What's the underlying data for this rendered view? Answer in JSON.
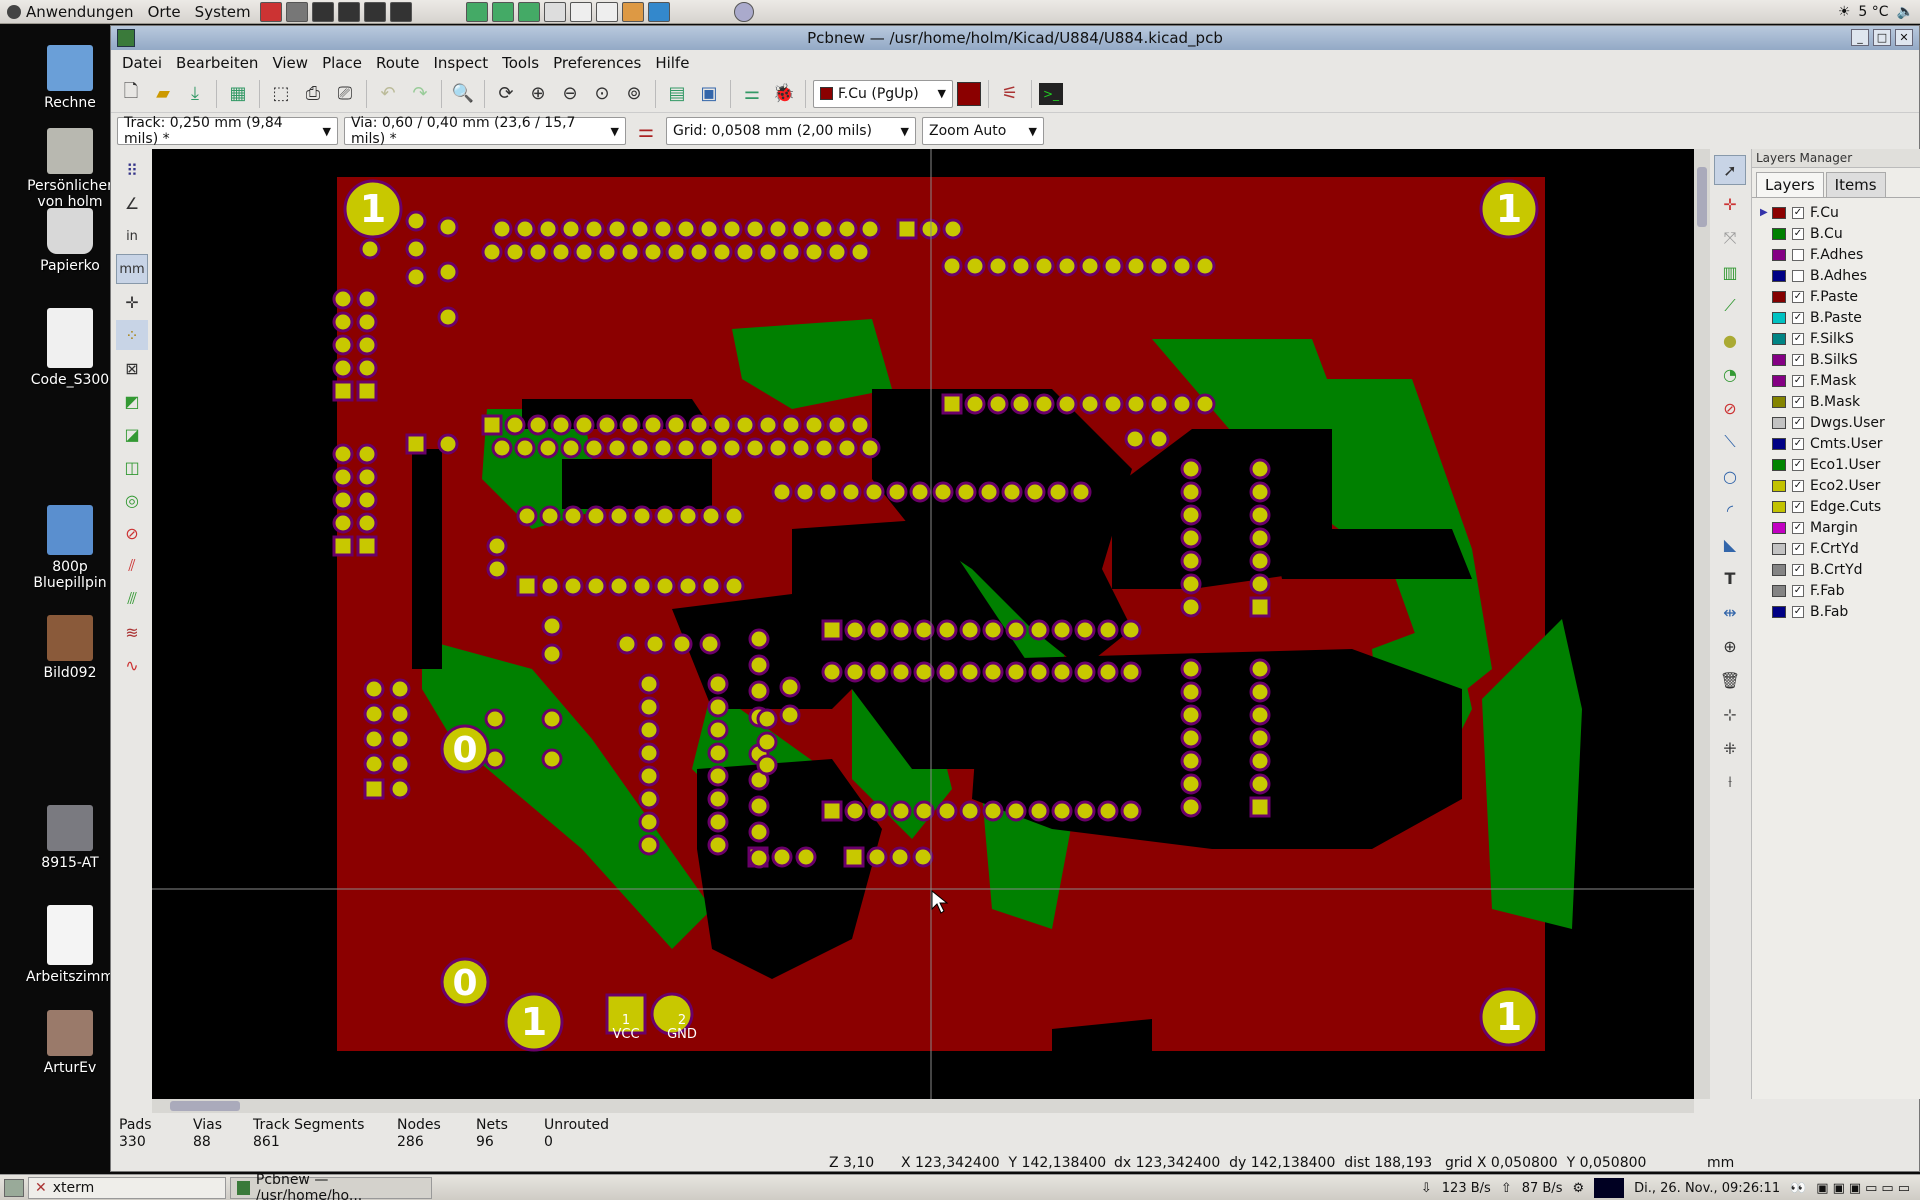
{
  "top_panel": {
    "menu": [
      "Anwendungen",
      "Orte",
      "System"
    ],
    "weather": "5 °C"
  },
  "desktop": {
    "icons": [
      "Rechne",
      "Persönlicher von holm",
      "Papierko",
      "Code_S300",
      "800p Bluepillpin",
      "Bild092",
      "8915-AT",
      "Arbeitszimm",
      "ArturEv"
    ]
  },
  "window": {
    "title": "Pcbnew — /usr/home/holm/Kicad/U884/U884.kicad_pcb",
    "menu": [
      "Datei",
      "Bearbeiten",
      "View",
      "Place",
      "Route",
      "Inspect",
      "Tools",
      "Preferences",
      "Hilfe"
    ],
    "layer_select": "F.Cu (PgUp)",
    "track": "Track: 0,250 mm (9,84 mils) *",
    "via": "Via: 0,60 / 0,40 mm (23,6 / 15,7 mils) *",
    "grid": "Grid: 0,0508 mm (2,00 mils)",
    "zoom": "Zoom Auto",
    "left_toolbar_units": [
      "in",
      "mm"
    ]
  },
  "canvas": {
    "corner_labels": [
      "1",
      "1",
      "1",
      "1",
      "1"
    ],
    "zero_labels": [
      "0",
      "0"
    ],
    "power_pads": [
      {
        "num": "1",
        "name": "VCC"
      },
      {
        "num": "2",
        "name": "GND"
      }
    ]
  },
  "layers_panel": {
    "title": "Layers Manager",
    "tabs": [
      "Layers",
      "Items"
    ],
    "layers": [
      {
        "name": "F.Cu",
        "color": "#8b0000",
        "checked": true
      },
      {
        "name": "B.Cu",
        "color": "#008000",
        "checked": true
      },
      {
        "name": "F.Adhes",
        "color": "#840084",
        "checked": false
      },
      {
        "name": "B.Adhes",
        "color": "#000084",
        "checked": false
      },
      {
        "name": "F.Paste",
        "color": "#840000",
        "checked": true
      },
      {
        "name": "B.Paste",
        "color": "#00c2c2",
        "checked": true
      },
      {
        "name": "F.SilkS",
        "color": "#008484",
        "checked": true
      },
      {
        "name": "B.SilkS",
        "color": "#840084",
        "checked": true
      },
      {
        "name": "F.Mask",
        "color": "#840084",
        "checked": true
      },
      {
        "name": "B.Mask",
        "color": "#848400",
        "checked": true
      },
      {
        "name": "Dwgs.User",
        "color": "#c2c2c2",
        "checked": true
      },
      {
        "name": "Cmts.User",
        "color": "#000084",
        "checked": true
      },
      {
        "name": "Eco1.User",
        "color": "#008400",
        "checked": true
      },
      {
        "name": "Eco2.User",
        "color": "#c2c200",
        "checked": true
      },
      {
        "name": "Edge.Cuts",
        "color": "#c2c200",
        "checked": true
      },
      {
        "name": "Margin",
        "color": "#c200c2",
        "checked": true
      },
      {
        "name": "F.CrtYd",
        "color": "#c2c2c2",
        "checked": true
      },
      {
        "name": "B.CrtYd",
        "color": "#848484",
        "checked": true
      },
      {
        "name": "F.Fab",
        "color": "#848484",
        "checked": true
      },
      {
        "name": "B.Fab",
        "color": "#000084",
        "checked": true
      }
    ]
  },
  "status": {
    "items": [
      {
        "label": "Pads",
        "value": "330"
      },
      {
        "label": "Vias",
        "value": "88"
      },
      {
        "label": "Track Segments",
        "value": "861"
      },
      {
        "label": "Nodes",
        "value": "286"
      },
      {
        "label": "Nets",
        "value": "96"
      },
      {
        "label": "Unrouted",
        "value": "0"
      }
    ],
    "zoom": "Z 3,10",
    "xy": "X 123,342400  Y 142,138400",
    "dxy": "dx 123,342400  dy 142,138400  dist 188,193",
    "grid": "grid X 0,050800  Y 0,050800",
    "units": "mm"
  },
  "taskbar": {
    "tasks": [
      "xterm",
      "Pcbnew — /usr/home/ho..."
    ],
    "net_down": "123 B/s",
    "net_up": "87 B/s",
    "clock": "Di., 26. Nov., 09:26:11"
  }
}
